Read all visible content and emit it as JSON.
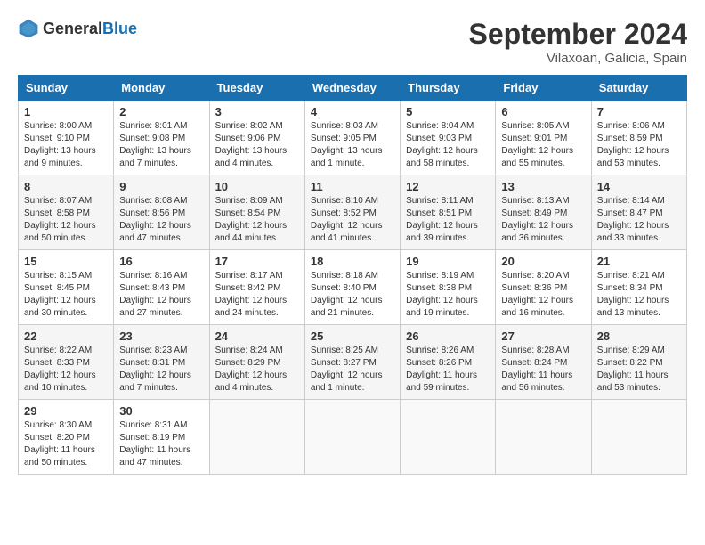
{
  "header": {
    "logo_general": "General",
    "logo_blue": "Blue",
    "month_year": "September 2024",
    "location": "Vilaxoan, Galicia, Spain"
  },
  "weekdays": [
    "Sunday",
    "Monday",
    "Tuesday",
    "Wednesday",
    "Thursday",
    "Friday",
    "Saturday"
  ],
  "weeks": [
    [
      {
        "day": 1,
        "info": "Sunrise: 8:00 AM\nSunset: 9:10 PM\nDaylight: 13 hours\nand 9 minutes."
      },
      {
        "day": 2,
        "info": "Sunrise: 8:01 AM\nSunset: 9:08 PM\nDaylight: 13 hours\nand 7 minutes."
      },
      {
        "day": 3,
        "info": "Sunrise: 8:02 AM\nSunset: 9:06 PM\nDaylight: 13 hours\nand 4 minutes."
      },
      {
        "day": 4,
        "info": "Sunrise: 8:03 AM\nSunset: 9:05 PM\nDaylight: 13 hours\nand 1 minute."
      },
      {
        "day": 5,
        "info": "Sunrise: 8:04 AM\nSunset: 9:03 PM\nDaylight: 12 hours\nand 58 minutes."
      },
      {
        "day": 6,
        "info": "Sunrise: 8:05 AM\nSunset: 9:01 PM\nDaylight: 12 hours\nand 55 minutes."
      },
      {
        "day": 7,
        "info": "Sunrise: 8:06 AM\nSunset: 8:59 PM\nDaylight: 12 hours\nand 53 minutes."
      }
    ],
    [
      {
        "day": 8,
        "info": "Sunrise: 8:07 AM\nSunset: 8:58 PM\nDaylight: 12 hours\nand 50 minutes."
      },
      {
        "day": 9,
        "info": "Sunrise: 8:08 AM\nSunset: 8:56 PM\nDaylight: 12 hours\nand 47 minutes."
      },
      {
        "day": 10,
        "info": "Sunrise: 8:09 AM\nSunset: 8:54 PM\nDaylight: 12 hours\nand 44 minutes."
      },
      {
        "day": 11,
        "info": "Sunrise: 8:10 AM\nSunset: 8:52 PM\nDaylight: 12 hours\nand 41 minutes."
      },
      {
        "day": 12,
        "info": "Sunrise: 8:11 AM\nSunset: 8:51 PM\nDaylight: 12 hours\nand 39 minutes."
      },
      {
        "day": 13,
        "info": "Sunrise: 8:13 AM\nSunset: 8:49 PM\nDaylight: 12 hours\nand 36 minutes."
      },
      {
        "day": 14,
        "info": "Sunrise: 8:14 AM\nSunset: 8:47 PM\nDaylight: 12 hours\nand 33 minutes."
      }
    ],
    [
      {
        "day": 15,
        "info": "Sunrise: 8:15 AM\nSunset: 8:45 PM\nDaylight: 12 hours\nand 30 minutes."
      },
      {
        "day": 16,
        "info": "Sunrise: 8:16 AM\nSunset: 8:43 PM\nDaylight: 12 hours\nand 27 minutes."
      },
      {
        "day": 17,
        "info": "Sunrise: 8:17 AM\nSunset: 8:42 PM\nDaylight: 12 hours\nand 24 minutes."
      },
      {
        "day": 18,
        "info": "Sunrise: 8:18 AM\nSunset: 8:40 PM\nDaylight: 12 hours\nand 21 minutes."
      },
      {
        "day": 19,
        "info": "Sunrise: 8:19 AM\nSunset: 8:38 PM\nDaylight: 12 hours\nand 19 minutes."
      },
      {
        "day": 20,
        "info": "Sunrise: 8:20 AM\nSunset: 8:36 PM\nDaylight: 12 hours\nand 16 minutes."
      },
      {
        "day": 21,
        "info": "Sunrise: 8:21 AM\nSunset: 8:34 PM\nDaylight: 12 hours\nand 13 minutes."
      }
    ],
    [
      {
        "day": 22,
        "info": "Sunrise: 8:22 AM\nSunset: 8:33 PM\nDaylight: 12 hours\nand 10 minutes."
      },
      {
        "day": 23,
        "info": "Sunrise: 8:23 AM\nSunset: 8:31 PM\nDaylight: 12 hours\nand 7 minutes."
      },
      {
        "day": 24,
        "info": "Sunrise: 8:24 AM\nSunset: 8:29 PM\nDaylight: 12 hours\nand 4 minutes."
      },
      {
        "day": 25,
        "info": "Sunrise: 8:25 AM\nSunset: 8:27 PM\nDaylight: 12 hours\nand 1 minute."
      },
      {
        "day": 26,
        "info": "Sunrise: 8:26 AM\nSunset: 8:26 PM\nDaylight: 11 hours\nand 59 minutes."
      },
      {
        "day": 27,
        "info": "Sunrise: 8:28 AM\nSunset: 8:24 PM\nDaylight: 11 hours\nand 56 minutes."
      },
      {
        "day": 28,
        "info": "Sunrise: 8:29 AM\nSunset: 8:22 PM\nDaylight: 11 hours\nand 53 minutes."
      }
    ],
    [
      {
        "day": 29,
        "info": "Sunrise: 8:30 AM\nSunset: 8:20 PM\nDaylight: 11 hours\nand 50 minutes."
      },
      {
        "day": 30,
        "info": "Sunrise: 8:31 AM\nSunset: 8:19 PM\nDaylight: 11 hours\nand 47 minutes."
      },
      {
        "day": null,
        "info": ""
      },
      {
        "day": null,
        "info": ""
      },
      {
        "day": null,
        "info": ""
      },
      {
        "day": null,
        "info": ""
      },
      {
        "day": null,
        "info": ""
      }
    ]
  ]
}
